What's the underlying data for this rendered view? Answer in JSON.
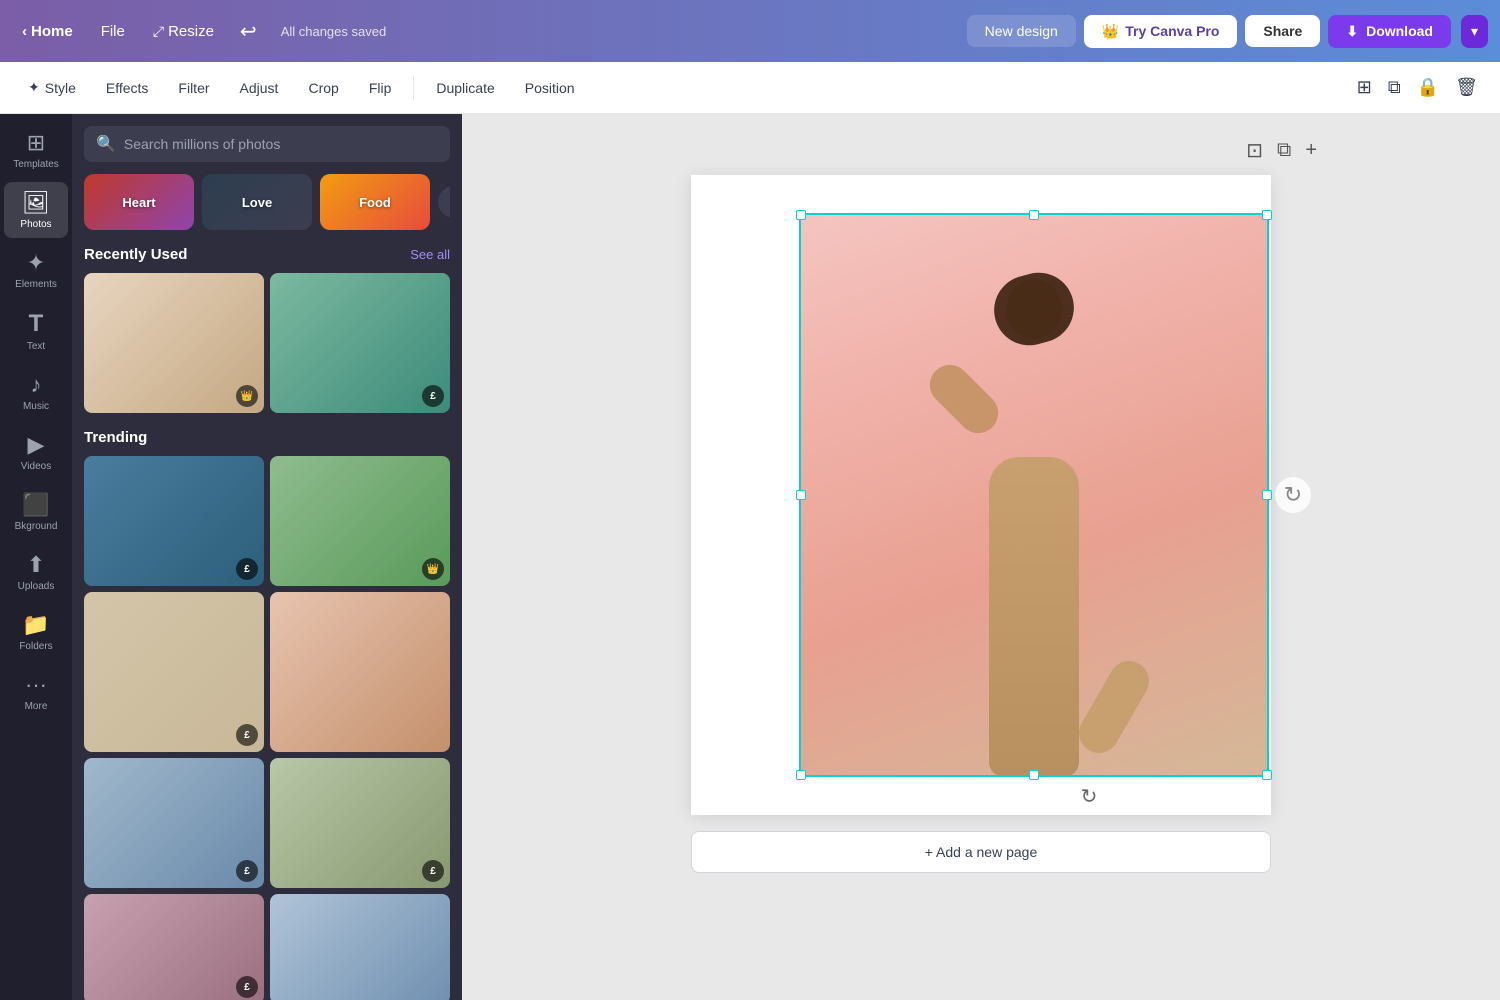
{
  "topnav": {
    "home_label": "Home",
    "file_label": "File",
    "resize_label": "Resize",
    "saved_label": "All changes saved",
    "new_design_label": "New design",
    "try_pro_label": "Try Canva Pro",
    "share_label": "Share",
    "download_label": "Download"
  },
  "toolbar": {
    "style_label": "Style",
    "effects_label": "Effects",
    "filter_label": "Filter",
    "adjust_label": "Adjust",
    "crop_label": "Crop",
    "flip_label": "Flip",
    "duplicate_label": "Duplicate",
    "position_label": "Position"
  },
  "sidebar": {
    "items": [
      {
        "id": "templates",
        "label": "Templates",
        "icon": "⊞"
      },
      {
        "id": "photos",
        "label": "Photos",
        "icon": "🖼"
      },
      {
        "id": "elements",
        "label": "Elements",
        "icon": "✦"
      },
      {
        "id": "text",
        "label": "Text",
        "icon": "T"
      },
      {
        "id": "music",
        "label": "Music",
        "icon": "♪"
      },
      {
        "id": "videos",
        "label": "Videos",
        "icon": "▶"
      },
      {
        "id": "background",
        "label": "Bkground",
        "icon": "⬛"
      },
      {
        "id": "uploads",
        "label": "Uploads",
        "icon": "⬆"
      },
      {
        "id": "folders",
        "label": "Folders",
        "icon": "📁"
      },
      {
        "id": "more",
        "label": "More",
        "icon": "···"
      }
    ]
  },
  "photos_panel": {
    "search_placeholder": "Search millions of photos",
    "categories": [
      {
        "id": "heart",
        "label": "Heart"
      },
      {
        "id": "love",
        "label": "Love"
      },
      {
        "id": "food",
        "label": "Food"
      }
    ],
    "recently_used_label": "Recently Used",
    "see_all_label": "See all",
    "trending_label": "Trending",
    "photos_recently": [
      {
        "color": "pc1",
        "badge": "👑",
        "height": "tall"
      },
      {
        "color": "pc2",
        "badge": "£",
        "height": "tall"
      }
    ],
    "photos_trending": [
      {
        "color": "pc3",
        "badge": "£",
        "height": "tall"
      },
      {
        "color": "pc4",
        "badge": "👑",
        "height": "tall"
      },
      {
        "color": "pc5",
        "badge": "£",
        "height": "tall"
      },
      {
        "color": "pc6",
        "badge": "",
        "height": "short"
      },
      {
        "color": "pc7",
        "badge": "£",
        "height": "tall"
      },
      {
        "color": "pc8",
        "badge": "£",
        "height": "tall"
      },
      {
        "color": "pc9",
        "badge": "£",
        "height": "tall"
      },
      {
        "color": "pc10",
        "badge": "",
        "height": "short"
      }
    ]
  },
  "canvas": {
    "add_page_label": "+ Add a new page"
  }
}
